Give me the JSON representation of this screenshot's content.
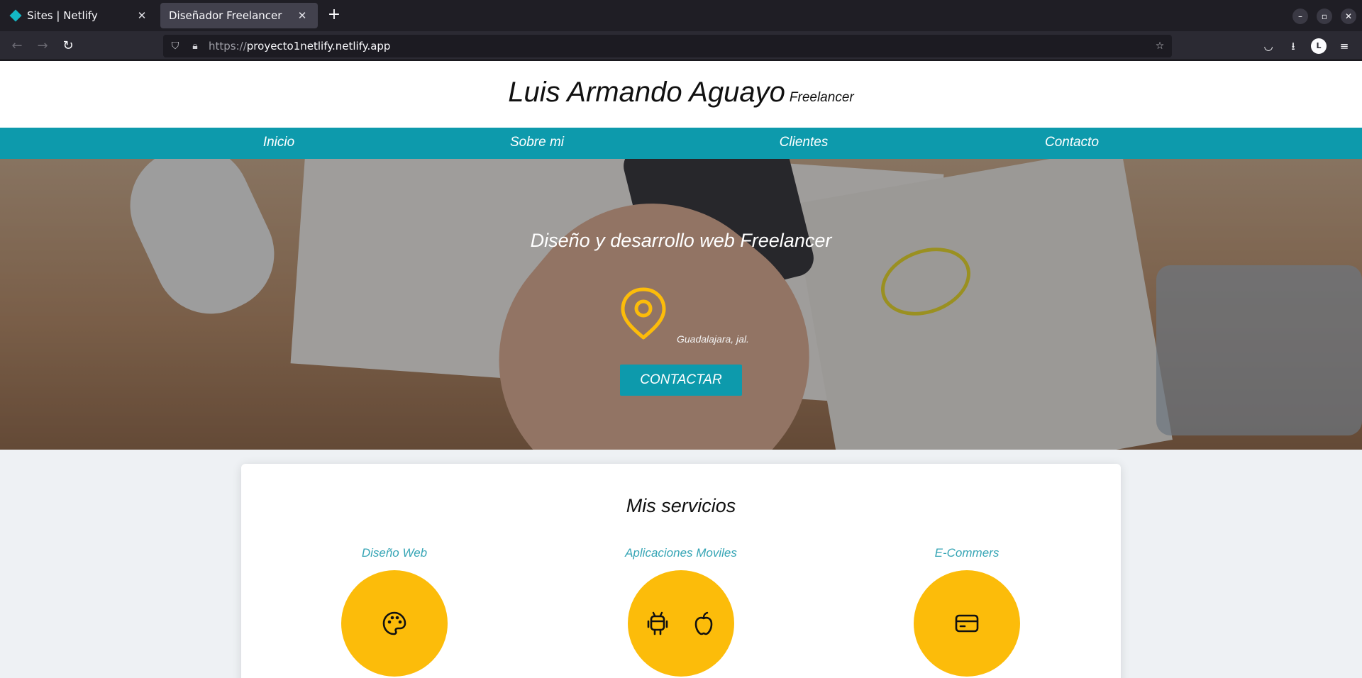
{
  "browser": {
    "tabs": [
      {
        "title": "Sites | Netlify"
      },
      {
        "title": "Diseñador Freelancer"
      }
    ],
    "url_proto": "https://",
    "url_host": "proyecto1netlify.netlify.app",
    "avatar_letter": "L"
  },
  "site": {
    "name": "Luis Armando Aguayo",
    "role": "Freelancer",
    "nav": [
      "Inicio",
      "Sobre mi",
      "Clientes",
      "Contacto"
    ],
    "hero": {
      "tagline": "Diseño y desarrollo web Freelancer",
      "location": "Guadalajara, jal.",
      "cta": "CONTACTAR"
    },
    "services": {
      "title": "Mis servicios",
      "items": [
        {
          "label": "Diseño Web",
          "icon": "palette-icon"
        },
        {
          "label": "Aplicaciones Moviles",
          "icon": "android-apple-icons"
        },
        {
          "label": "E-Commers",
          "icon": "credit-card-icon"
        }
      ]
    }
  },
  "colors": {
    "accent": "#0d9aac",
    "yellow": "#fcbc0a",
    "service_label": "#36a5b5"
  }
}
